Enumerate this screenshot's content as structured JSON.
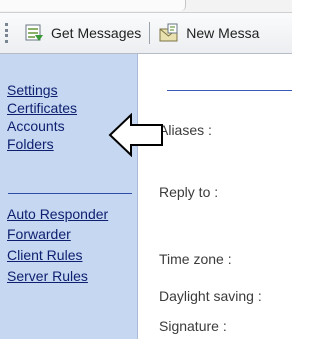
{
  "toolbar": {
    "get_messages_label": "Get Messages",
    "new_message_label": "New Messa",
    "icons": [
      "get-messages-icon",
      "new-message-icon"
    ]
  },
  "sidebar": {
    "items": [
      {
        "label": "Settings"
      },
      {
        "label": "Certificates"
      },
      {
        "label": "Accounts"
      },
      {
        "label": "Folders"
      },
      {
        "label": "Auto Responder"
      },
      {
        "label": "Forwarder"
      },
      {
        "label": "Client Rules"
      },
      {
        "label": "Server Rules"
      }
    ]
  },
  "main": {
    "fields": [
      {
        "label": "Aliases :"
      },
      {
        "label": "Reply to :"
      },
      {
        "label": "Time zone :"
      },
      {
        "label": "Daylight saving :"
      },
      {
        "label": "Signature :"
      }
    ]
  },
  "annotation": {
    "icon": "left-arrow-icon"
  },
  "colors": {
    "sidebar_bg": "#c5d7f1",
    "link": "#0d1f6e",
    "separator": "#2e4ea7"
  }
}
